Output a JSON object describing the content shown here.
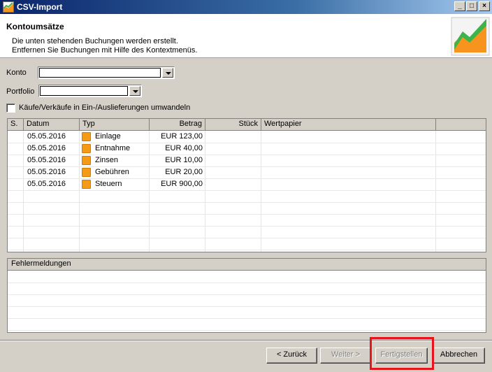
{
  "window": {
    "title": "CSV-Import",
    "controls": [
      "_",
      "□",
      "×"
    ]
  },
  "header": {
    "title": "Kontoumsätze",
    "description_line1": "Die unten stehenden Buchungen werden erstellt.",
    "description_line2": "Entfernen Sie Buchungen mit Hilfe des Kontextmenüs."
  },
  "form": {
    "konto_label": "Konto",
    "konto_value": "",
    "portfolio_label": "Portfolio",
    "portfolio_value": "",
    "convert_checkbox_label": "Käufe/Verkäufe in Ein-/Auslieferungen umwandeln",
    "convert_checked": false
  },
  "table": {
    "columns": [
      "S.",
      "Datum",
      "Typ",
      "Betrag",
      "Stück",
      "Wertpapier"
    ],
    "rows": [
      {
        "datum": "05.05.2016",
        "typ": "Einlage",
        "betrag": "EUR 123,00",
        "stueck": "",
        "wertpapier": ""
      },
      {
        "datum": "05.05.2016",
        "typ": "Entnahme",
        "betrag": "EUR 40,00",
        "stueck": "",
        "wertpapier": ""
      },
      {
        "datum": "05.05.2016",
        "typ": "Zinsen",
        "betrag": "EUR 10,00",
        "stueck": "",
        "wertpapier": ""
      },
      {
        "datum": "05.05.2016",
        "typ": "Gebühren",
        "betrag": "EUR 20,00",
        "stueck": "",
        "wertpapier": ""
      },
      {
        "datum": "05.05.2016",
        "typ": "Steuern",
        "betrag": "EUR 900,00",
        "stueck": "",
        "wertpapier": ""
      }
    ],
    "type_icon": "orange-square-icon"
  },
  "errors": {
    "header": "Fehlermeldungen"
  },
  "buttons": {
    "back": "< Zurück",
    "next": "Weiter >",
    "finish": "Fertigstellen",
    "cancel": "Abbrechen"
  },
  "colors": {
    "highlight": "#e8141c",
    "type_icon": "#f59a16",
    "title_bar": "#0a246a"
  }
}
